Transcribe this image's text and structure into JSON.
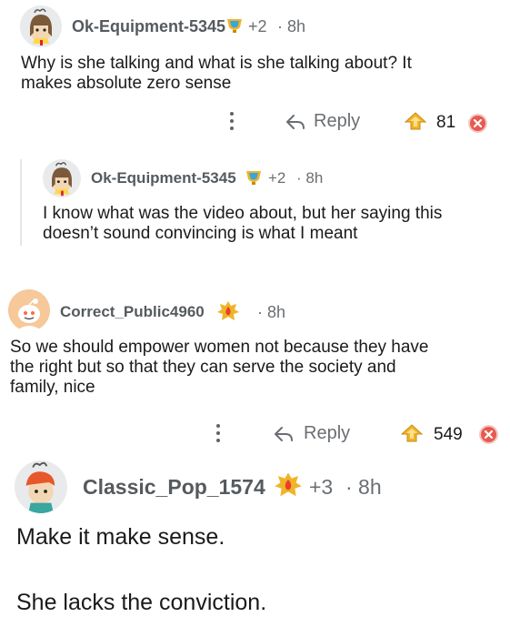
{
  "comments": [
    {
      "username": "Ok-Equipment-5345",
      "awards": "+2",
      "time": "· 8h",
      "body": [
        "Why is she talking and what is she talking about? It",
        "makes absolute zero sense"
      ],
      "reply_label": "Reply",
      "score": "81"
    },
    {
      "username": "Ok-Equipment-5345",
      "awards": "+2",
      "time": "· 8h",
      "body": [
        "I know what was the video about, but her saying this",
        "doesn’t sound convincing is what I meant"
      ]
    },
    {
      "username": "Correct_Public4960",
      "awards": "",
      "time": "· 8h",
      "body": [
        "So we should empower women not because they have",
        "the right but so that they can serve the society and",
        "family, nice"
      ],
      "reply_label": "Reply",
      "score": "549"
    },
    {
      "username": "Classic_Pop_1574",
      "awards": "+3",
      "time": "· 8h",
      "body": [
        "Make it make sense.",
        "",
        "She lacks the conviction."
      ]
    }
  ],
  "icons": {
    "more": "more-options-icon",
    "reply": "reply-arrow-icon",
    "upvote": "upvote-icon",
    "close": "close-icon",
    "award_trophy": "trophy-award-icon",
    "award_fire": "fire-award-icon"
  },
  "colors": {
    "username": "#555a5e",
    "meta": "#6a6e72",
    "close": "#e85a4f",
    "award_gold": "#f0b429",
    "thread_line": "#e6e6e6"
  }
}
